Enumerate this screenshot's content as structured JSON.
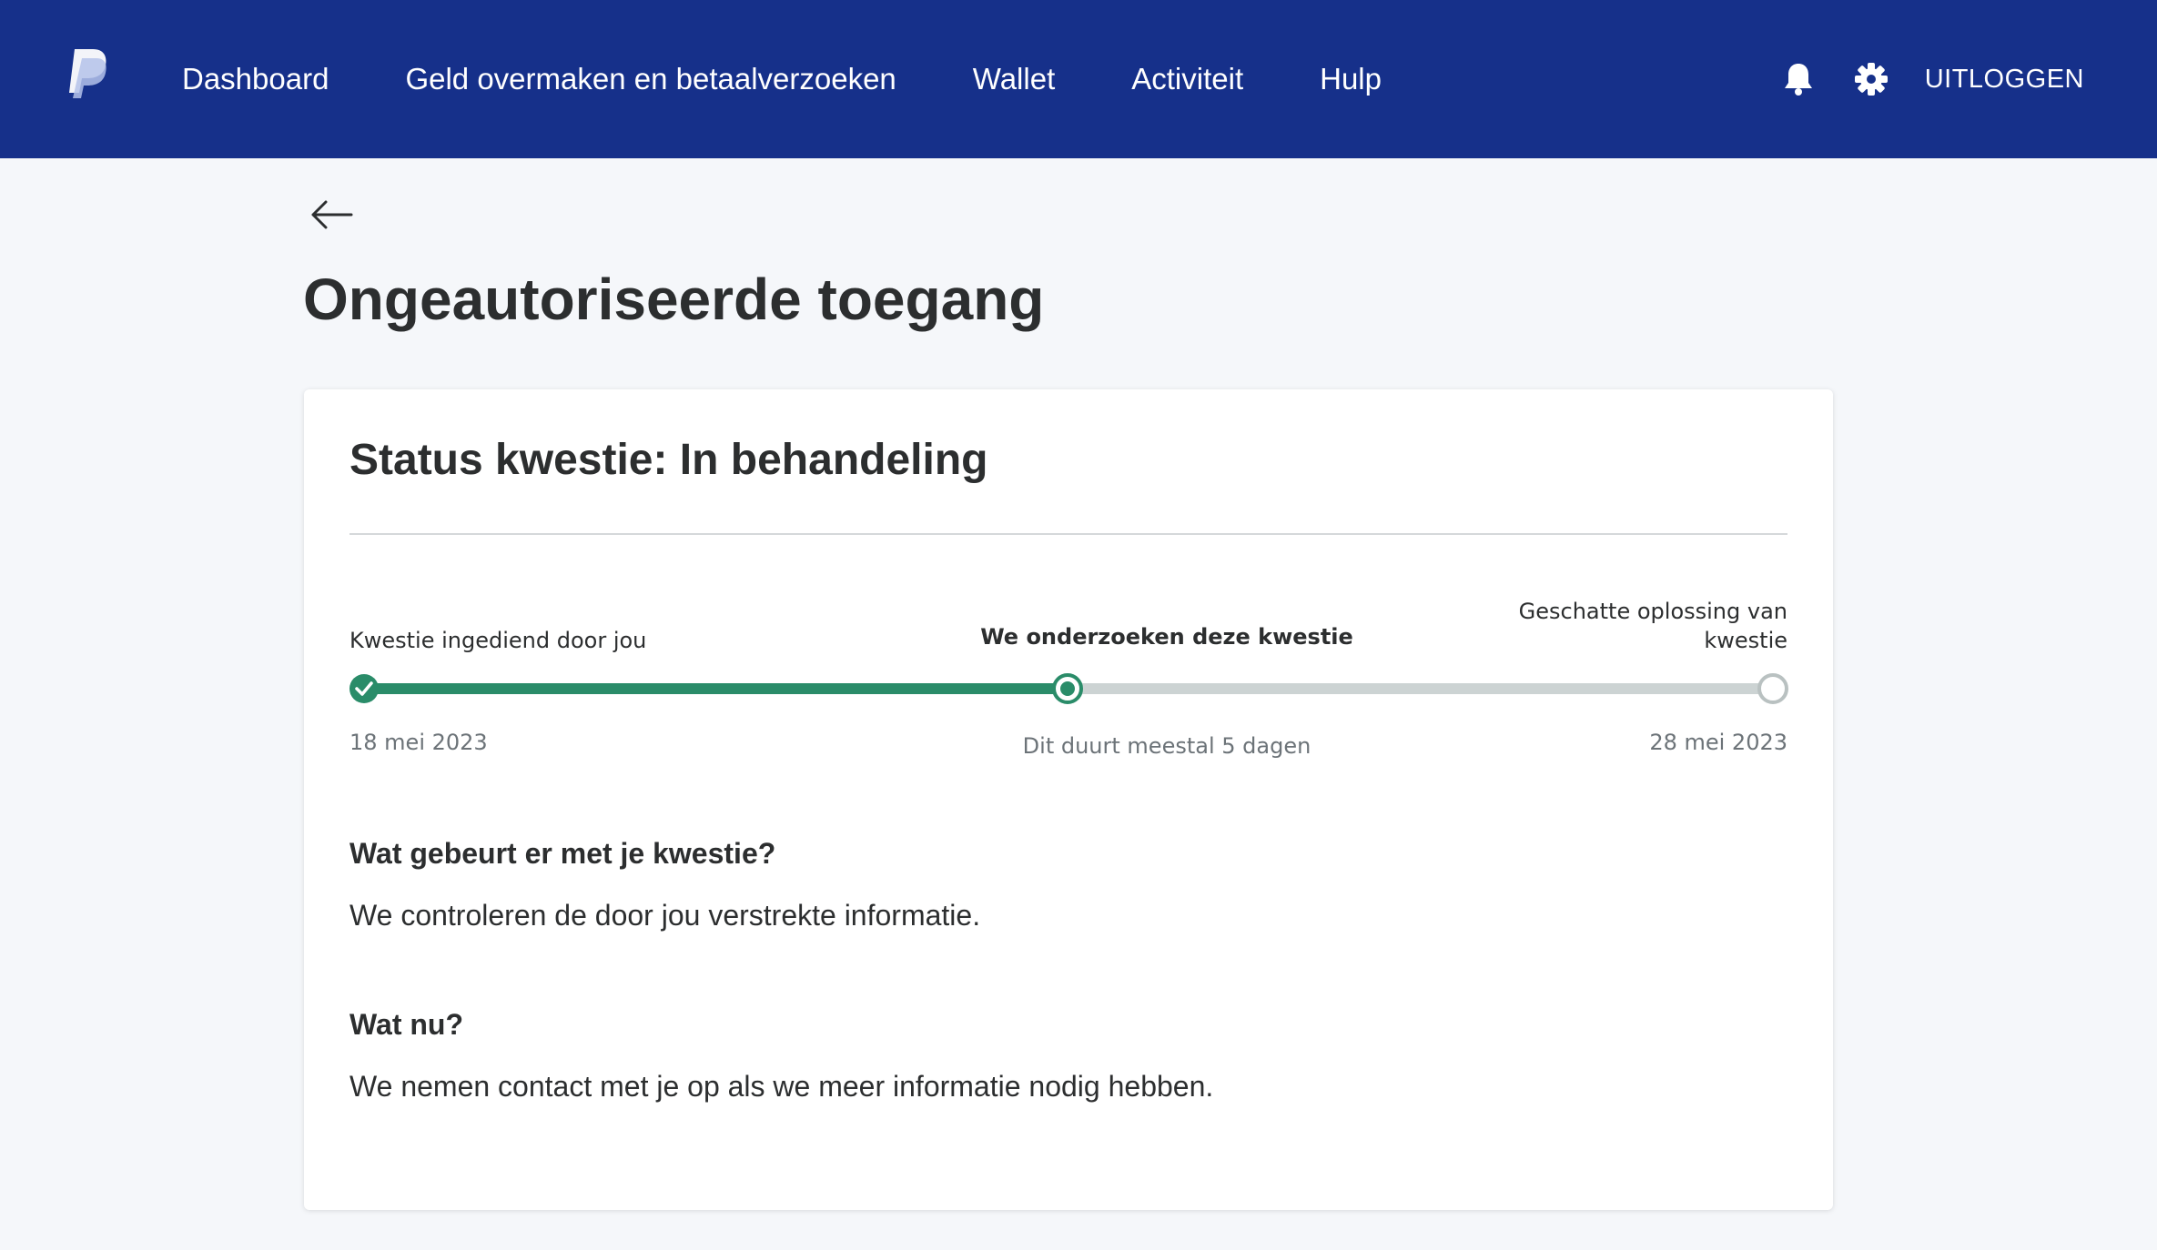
{
  "header": {
    "nav": [
      "Dashboard",
      "Geld overmaken en betaalverzoeken",
      "Wallet",
      "Activiteit",
      "Hulp"
    ],
    "logout_label": "UITLOGGEN",
    "icons": {
      "logo": "paypal-logo",
      "notifications": "bell-icon",
      "settings": "gear-icon"
    },
    "bg_color": "#16308a"
  },
  "page": {
    "title": "Ongeautoriseerde toegang",
    "back_icon": "arrow-left-icon"
  },
  "card": {
    "status_title": "Status kwestie: In behandeling",
    "progress": {
      "fraction_complete": 0.5,
      "steps": [
        {
          "label_line1": "Kwestie ingediend door jou",
          "label_line2": "",
          "sub": "18 mei 2023",
          "state": "done"
        },
        {
          "label_line1": "We onderzoeken deze kwestie",
          "label_line2": "",
          "sub": "Dit duurt meestal 5 dagen",
          "state": "current"
        },
        {
          "label_line1": "Geschatte oplossing van",
          "label_line2": "kwestie",
          "sub": "28 mei 2023",
          "state": "pending"
        }
      ],
      "colors": {
        "done": "#2a8c69",
        "pending": "#ccd3d3"
      }
    },
    "sections": [
      {
        "heading": "Wat gebeurt er met je kwestie?",
        "body": "We controleren de door jou verstrekte informatie."
      },
      {
        "heading": "Wat nu?",
        "body": "We nemen contact met je op als we meer informatie nodig hebben."
      }
    ]
  }
}
